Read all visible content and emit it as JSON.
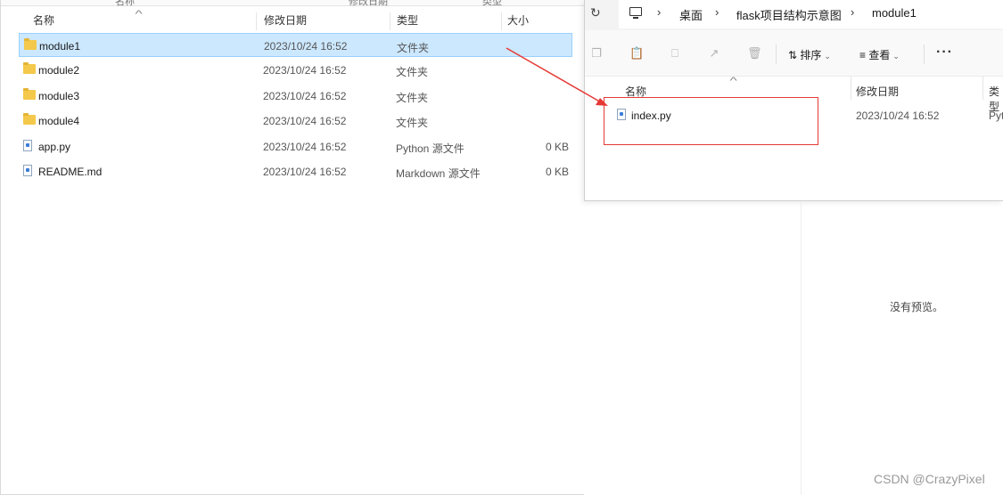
{
  "left_window": {
    "top_cut_labels": [
      "名称",
      "修改日期",
      "类型"
    ],
    "columns": {
      "name": "名称",
      "date": "修改日期",
      "type": "类型",
      "size": "大小"
    },
    "rows": [
      {
        "name": "module1",
        "date": "2023/10/24 16:52",
        "type": "文件夹",
        "size": "",
        "icon": "folder-icon",
        "selected": true
      },
      {
        "name": "module2",
        "date": "2023/10/24 16:52",
        "type": "文件夹",
        "size": "",
        "icon": "folder-icon",
        "selected": false
      },
      {
        "name": "module3",
        "date": "2023/10/24 16:52",
        "type": "文件夹",
        "size": "",
        "icon": "folder-icon",
        "selected": false
      },
      {
        "name": "module4",
        "date": "2023/10/24 16:52",
        "type": "文件夹",
        "size": "",
        "icon": "folder-icon",
        "selected": false
      },
      {
        "name": "app.py",
        "date": "2023/10/24 16:52",
        "type": "Python 源文件",
        "size": "0 KB",
        "icon": "python-file-icon",
        "selected": false
      },
      {
        "name": "README.md",
        "date": "2023/10/24 16:52",
        "type": "Markdown 源文件",
        "size": "0 KB",
        "icon": "markdown-file-icon",
        "selected": false
      }
    ]
  },
  "right_window": {
    "breadcrumb": [
      "桌面",
      "flask项目结构示意图",
      "module1"
    ],
    "toolbar": {
      "sort_label": "排序",
      "view_label": "查看",
      "more": "···"
    },
    "columns": {
      "name": "名称",
      "date": "修改日期",
      "type": "类型"
    },
    "file": {
      "name": "index.py",
      "date": "2023/10/24 16:52",
      "type": "Pyt"
    }
  },
  "preview": {
    "text": "没有预览。"
  },
  "watermark": "CSDN @CrazyPixel",
  "colors": {
    "selection_bg": "#cce8ff",
    "selection_border": "#99d1ff",
    "annotation": "#e53935",
    "folder": "#f4c84a"
  }
}
